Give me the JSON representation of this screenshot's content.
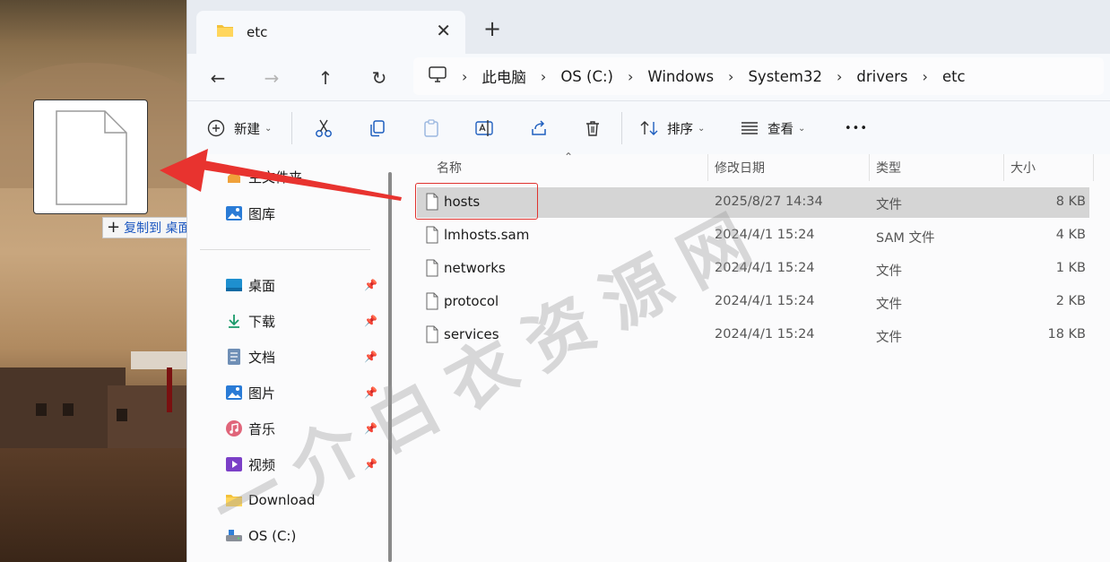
{
  "drag": {
    "tooltip_plus": "+",
    "tooltip_text": "复制到 桌面"
  },
  "tab": {
    "title": "etc",
    "close_glyph": "✕",
    "new_tab_glyph": "+"
  },
  "nav": {
    "back_glyph": "←",
    "forward_glyph": "→",
    "up_glyph": "↑",
    "refresh_glyph": "↻"
  },
  "breadcrumbs": [
    "此电脑",
    "OS (C:)",
    "Windows",
    "System32",
    "drivers",
    "etc"
  ],
  "toolbar": {
    "new_label": "新建",
    "sort_label": "排序",
    "view_label": "查看",
    "more_glyph": "•••"
  },
  "sidebar": {
    "top_items": [
      {
        "label": "主文件夹",
        "icon": "home-icon"
      },
      {
        "label": "图库",
        "icon": "gallery-icon"
      }
    ],
    "pinned_items": [
      {
        "label": "桌面",
        "icon": "desktop-icon",
        "pinned": true
      },
      {
        "label": "下载",
        "icon": "download-icon",
        "pinned": true
      },
      {
        "label": "文档",
        "icon": "document-icon",
        "pinned": true
      },
      {
        "label": "图片",
        "icon": "pictures-icon",
        "pinned": true
      },
      {
        "label": "音乐",
        "icon": "music-icon",
        "pinned": true
      },
      {
        "label": "视频",
        "icon": "video-icon",
        "pinned": true
      },
      {
        "label": "Download",
        "icon": "folder-icon",
        "pinned": false
      },
      {
        "label": "OS (C:)",
        "icon": "drive-icon",
        "pinned": false
      }
    ]
  },
  "columns": {
    "name": "名称",
    "modified": "修改日期",
    "type": "类型",
    "size": "大小"
  },
  "files": [
    {
      "name": "hosts",
      "modified": "2025/8/27 14:34",
      "type": "文件",
      "size": "8 KB",
      "selected": true
    },
    {
      "name": "lmhosts.sam",
      "modified": "2024/4/1 15:24",
      "type": "SAM 文件",
      "size": "4 KB",
      "selected": false
    },
    {
      "name": "networks",
      "modified": "2024/4/1 15:24",
      "type": "文件",
      "size": "1 KB",
      "selected": false
    },
    {
      "name": "protocol",
      "modified": "2024/4/1 15:24",
      "type": "文件",
      "size": "2 KB",
      "selected": false
    },
    {
      "name": "services",
      "modified": "2024/4/1 15:24",
      "type": "文件",
      "size": "18 KB",
      "selected": false
    }
  ],
  "watermark": "一介白衣资源网",
  "colors": {
    "highlight": "#e0332f",
    "arrow": "#e8332f",
    "selected_row": "#d5d5d5",
    "tooltip_text": "#1a56c0"
  }
}
